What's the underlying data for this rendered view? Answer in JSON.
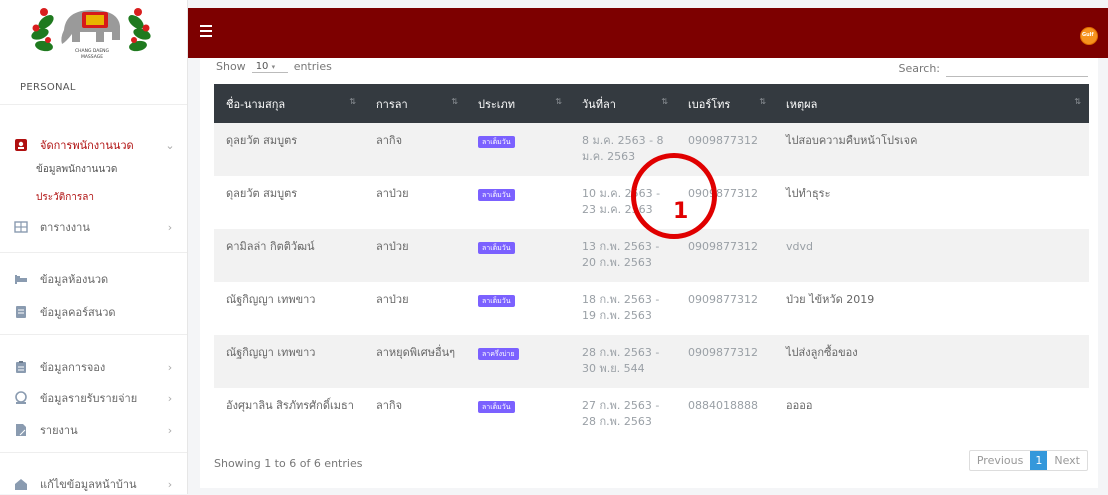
{
  "sidebar": {
    "section_title": "PERSONAL",
    "items": [
      {
        "label": "จัดการพนักงานนวด",
        "icon": "person-badge-icon",
        "chevron": "⌄"
      },
      {
        "label": "ตารางงาน",
        "icon": "calendar-grid-icon",
        "chevron": "›"
      },
      {
        "label": "ข้อมูลห้องนวด",
        "icon": "bed-icon",
        "chevron": ""
      },
      {
        "label": "ข้อมูลคอร์สนวด",
        "icon": "list-icon",
        "chevron": ""
      },
      {
        "label": "ข้อมูลการจอง",
        "icon": "clipboard-icon",
        "chevron": "›"
      },
      {
        "label": "ข้อมูลรายรับรายจ่าย",
        "icon": "money-icon",
        "chevron": "›"
      },
      {
        "label": "รายงาน",
        "icon": "report-icon",
        "chevron": "›"
      },
      {
        "label": "แก้ไขข้อมูลหน้าบ้าน",
        "icon": "home-icon",
        "chevron": "›"
      }
    ],
    "sub_items": [
      {
        "label": "ข้อมูลพนักงานนวด"
      },
      {
        "label": "ประวัติการลา"
      }
    ]
  },
  "header": {
    "menu_icon": "hamburger-icon",
    "avatar_text": "Gulf"
  },
  "table_controls": {
    "show_label": "Show",
    "entries_value": "10",
    "entries_label": "entries",
    "search_label": "Search:",
    "search_value": ""
  },
  "table": {
    "columns": [
      "ชื่อ-นามสกุล",
      "การลา",
      "ประเภท",
      "วันที่ลา",
      "เบอร์โทร",
      "เหตุผล"
    ],
    "rows": [
      {
        "name": "ดุลยวัต สมบูตร",
        "leave": "ลากิจ",
        "type": "ลาเต็มวัน",
        "date1": "8 ม.ค. 2563 - 8",
        "date2": "ม.ค. 2563",
        "phone": "0909877312",
        "reason": "ไปสอบความคืบหน้าโปรเจค"
      },
      {
        "name": "ดุลยวัต สมบูตร",
        "leave": "ลาป่วย",
        "type": "ลาเต็มวัน",
        "date1": "10 ม.ค. 2563 -",
        "date2": "23 ม.ค. 2563",
        "phone": "0909877312",
        "reason": "ไปทำธุระ"
      },
      {
        "name": "คามิลล่า กิตติวัฒน์",
        "leave": "ลาป่วย",
        "type": "ลาเต็มวัน",
        "date1": "13 ก.พ. 2563 -",
        "date2": "20 ก.พ. 2563",
        "phone": "0909877312",
        "reason": "vdvd"
      },
      {
        "name": "ณัฐกิญญา เทพขาว",
        "leave": "ลาป่วย",
        "type": "ลาเต็มวัน",
        "date1": "18 ก.พ. 2563 -",
        "date2": "19 ก.พ. 2563",
        "phone": "0909877312",
        "reason": "ป่วย ไข้หวัด 2019"
      },
      {
        "name": "ณัฐกิญญา เทพขาว",
        "leave": "ลาหยุดพิเศษอื่นๆ",
        "type": "ลาครึ่งบ่าย",
        "date1": "28 ก.พ. 2563 -",
        "date2": "30 พ.ย. 544",
        "phone": "0909877312",
        "reason": "ไปส่งลูกซื้อของ"
      },
      {
        "name": "อังศุมาลิน สิรภัทรศักดิ์เมธา",
        "leave": "ลากิจ",
        "type": "ลาเต็มวัน",
        "date1": "27 ก.พ. 2563 -",
        "date2": "28 ก.พ. 2563",
        "phone": "0884018888",
        "reason": "ออออ"
      }
    ]
  },
  "footer": {
    "info": "Showing 1 to 6 of 6 entries",
    "prev": "Previous",
    "page": "1",
    "next": "Next"
  },
  "annotation": {
    "label": "1",
    "color": "#e00000"
  },
  "colors": {
    "topbar": "#7d0000",
    "table_header": "#343a40",
    "badge": "#7b61ff",
    "active_page": "#3498db"
  }
}
